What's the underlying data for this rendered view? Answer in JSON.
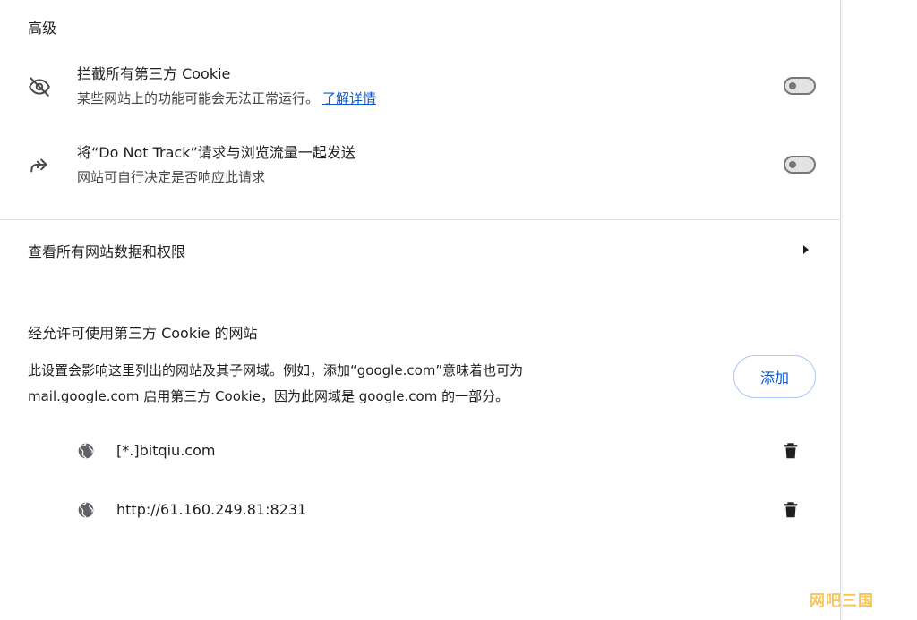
{
  "advanced": {
    "title": "高级",
    "block_third_party": {
      "label": "拦截所有第三方 Cookie",
      "description": "某些网站上的功能可能会无法正常运行。",
      "learn_more": "了解详情",
      "enabled": false
    },
    "do_not_track": {
      "label": "将“Do Not Track”请求与浏览流量一起发送",
      "description": "网站可自行决定是否响应此请求",
      "enabled": false
    }
  },
  "view_all_sites": {
    "label": "查看所有网站数据和权限"
  },
  "allowed_sites": {
    "title": "经允许可使用第三方 Cookie 的网站",
    "description_line1": "此设置会影响这里列出的网站及其子网域。例如，添加“google.com”意味着也可为",
    "description_line2": "mail.google.com 启用第三方 Cookie，因为此网域是 google.com 的一部分。",
    "add_label": "添加",
    "sites": [
      {
        "name": "[*.]bitqiu.com"
      },
      {
        "name": "http://61.160.249.81:8231"
      }
    ]
  },
  "watermark": "网吧三国",
  "colors": {
    "accent": "#0b57d0",
    "toggle_off": "#747775",
    "watermark": "#f6c65b"
  }
}
